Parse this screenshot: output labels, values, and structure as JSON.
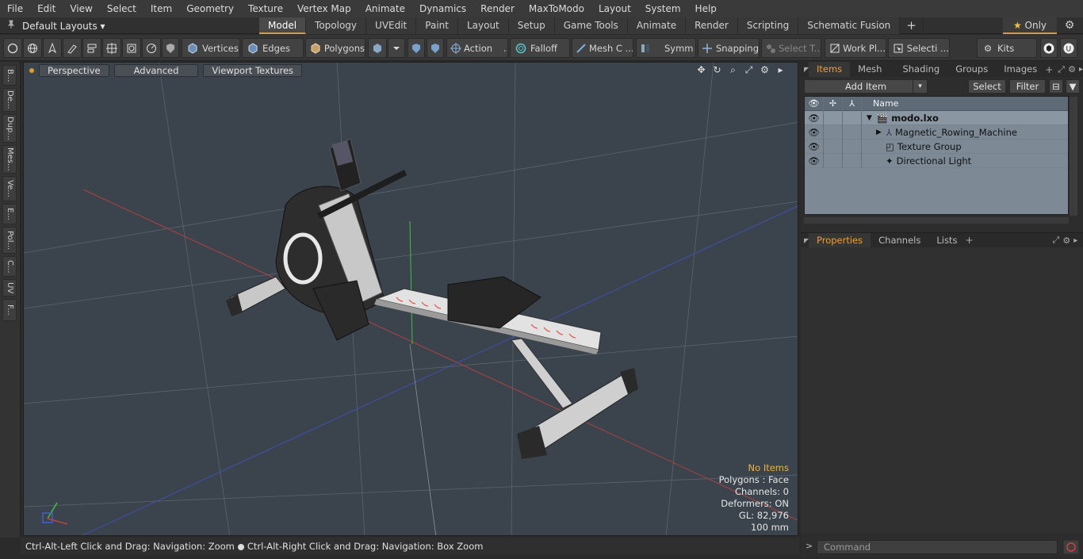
{
  "menu": [
    "File",
    "Edit",
    "View",
    "Select",
    "Item",
    "Geometry",
    "Texture",
    "Vertex Map",
    "Animate",
    "Dynamics",
    "Render",
    "MaxToModo",
    "Layout",
    "System",
    "Help"
  ],
  "layouts": {
    "label": "Default Layouts ▾"
  },
  "tabs": [
    {
      "label": "Model",
      "active": true
    },
    {
      "label": "Topology"
    },
    {
      "label": "UVEdit"
    },
    {
      "label": "Paint"
    },
    {
      "label": "Layout"
    },
    {
      "label": "Setup"
    },
    {
      "label": "Game Tools"
    },
    {
      "label": "Animate"
    },
    {
      "label": "Render"
    },
    {
      "label": "Scripting"
    },
    {
      "label": "Schematic Fusion"
    }
  ],
  "only_label": "Only",
  "toolbar": {
    "vertices": "Vertices",
    "edges": "Edges",
    "polygons": "Polygons",
    "action": "Action",
    "falloff": "Falloff",
    "mesh": "Mesh C ...",
    "symm": "Symm ...",
    "snapping": "Snapping",
    "select_t": "Select T...",
    "workpl": "Work Pl...",
    "selecti": "Selecti ...",
    "kits": "Kits"
  },
  "left_tabs": [
    "B...",
    "De...",
    "Dup...",
    "Mes...",
    "Ve...",
    "E...",
    "Pol...",
    "C...",
    "UV",
    "F..."
  ],
  "viewport": {
    "perspective": "Perspective",
    "advanced": "Advanced",
    "textures": "Viewport Textures",
    "stats": {
      "items": "No Items",
      "polygons": "Polygons : Face",
      "channels": "Channels: 0",
      "deformers": "Deformers: ON",
      "gl": "GL: 82,976",
      "unit": "100 mm"
    }
  },
  "status": {
    "left": "Ctrl-Alt-Left Click and Drag: Navigation: Zoom",
    "right": "Ctrl-Alt-Right Click and Drag: Navigation: Box Zoom"
  },
  "panel": {
    "tabs": [
      "Items",
      "Mesh ...",
      "Shading",
      "Groups",
      "Images"
    ],
    "add_item": "Add Item",
    "select": "Select",
    "filter": "Filter",
    "col_name": "Name",
    "tree": [
      {
        "label": "modo.lxo",
        "bold": true
      },
      {
        "label": "Magnetic_Rowing_Machine"
      },
      {
        "label": "Texture Group"
      },
      {
        "label": "Directional Light"
      }
    ],
    "props_tabs": [
      "Properties",
      "Channels",
      "Lists"
    ],
    "command_placeholder": "Command"
  },
  "colors": {
    "accent": "#e39a2d",
    "viewport_bg": "#3b444c",
    "tree_bg": "#7d8a96"
  }
}
